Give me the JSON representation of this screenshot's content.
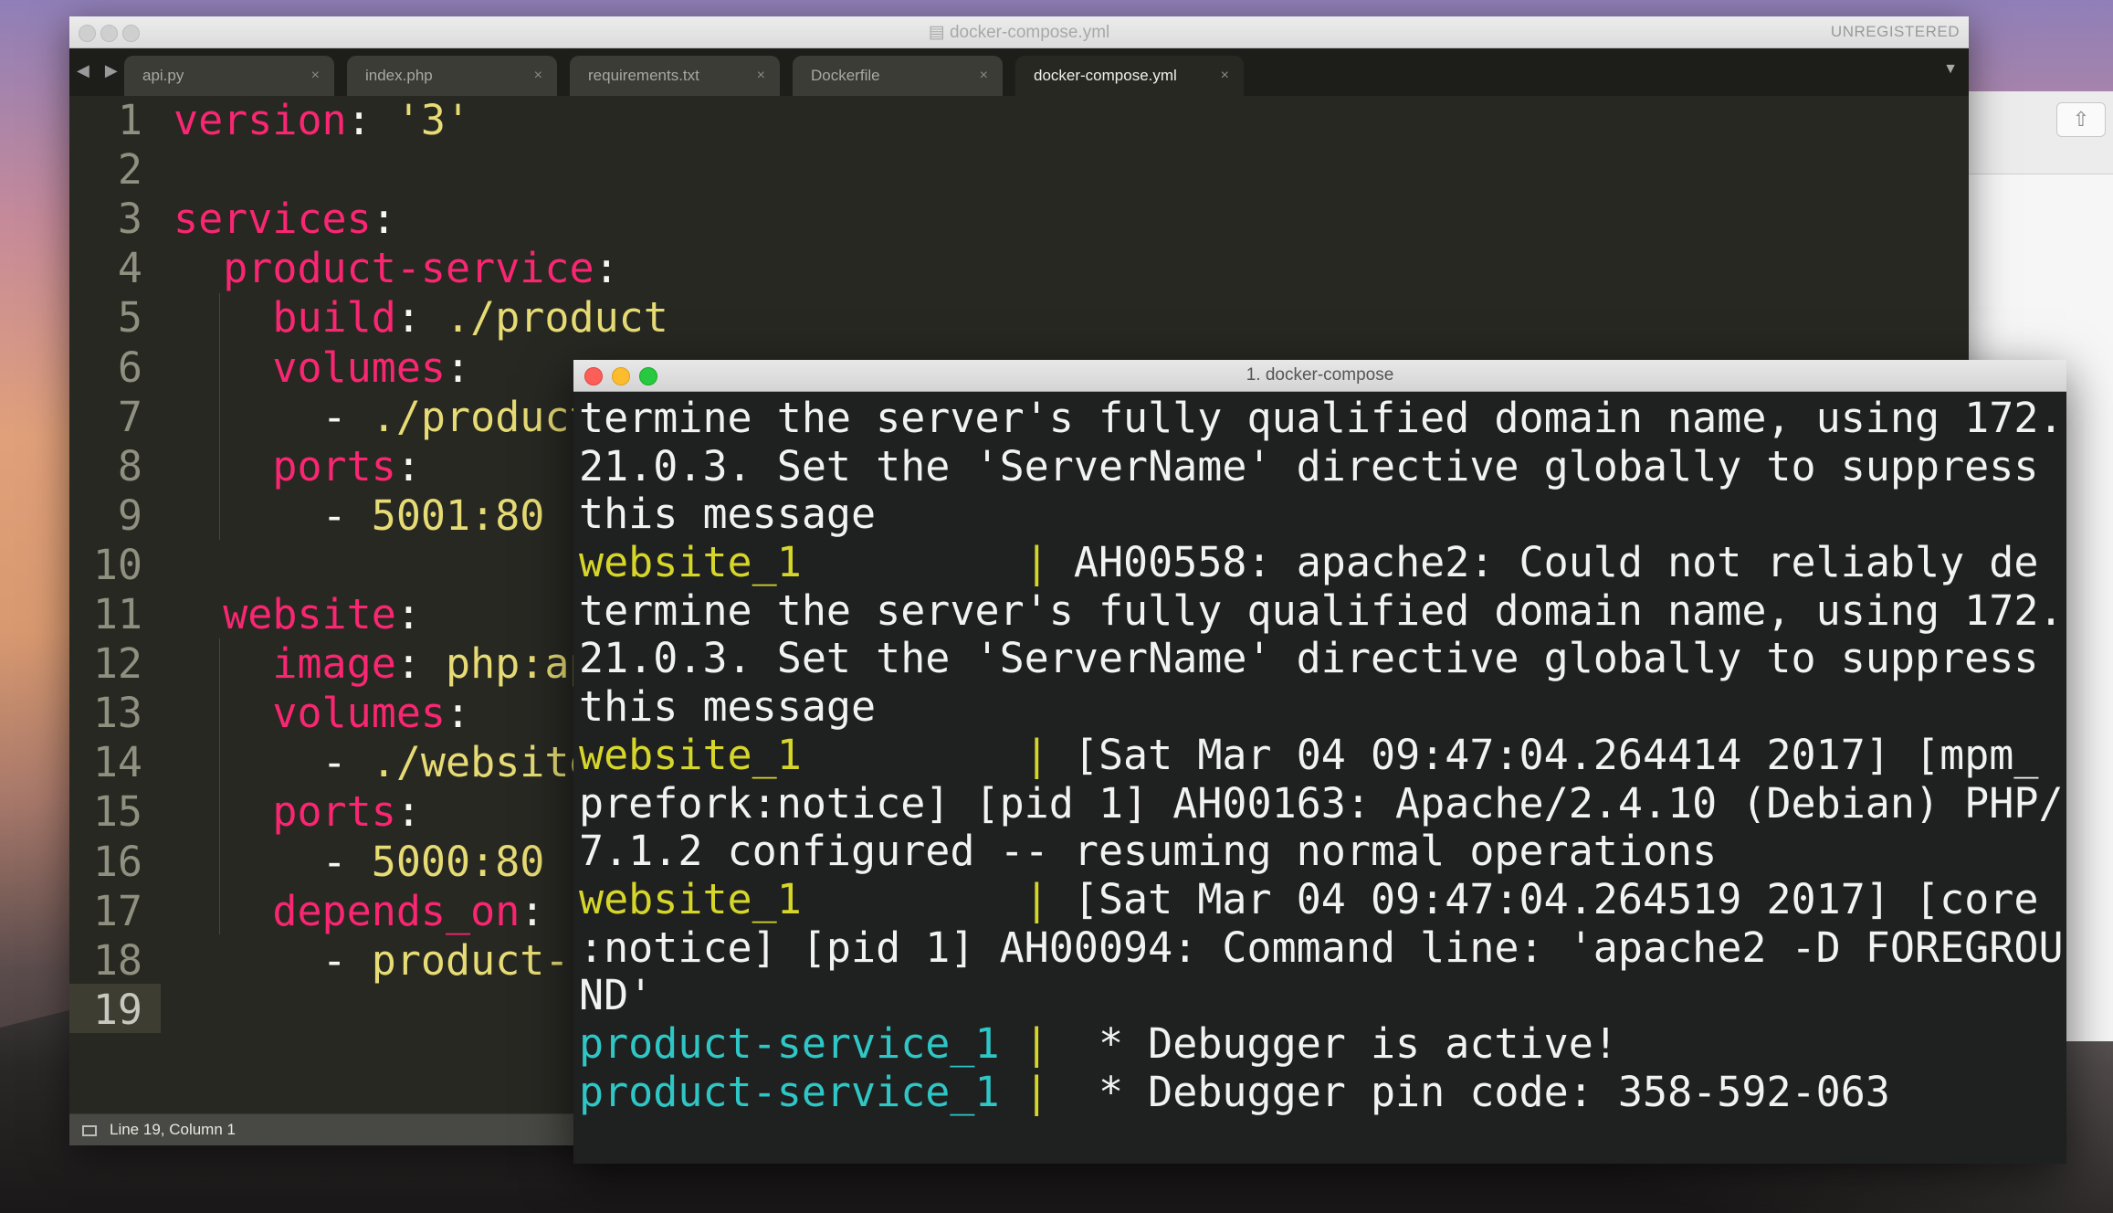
{
  "desktop": {
    "share_icon": "share-icon"
  },
  "sublime": {
    "window_title": "docker-compose.yml",
    "license_label": "UNREGISTERED",
    "nav_arrows": "◀ ▶",
    "tabs": [
      {
        "label": "api.py",
        "close": "×",
        "active": false
      },
      {
        "label": "index.php",
        "close": "×",
        "active": false
      },
      {
        "label": "requirements.txt",
        "close": "×",
        "active": false
      },
      {
        "label": "Dockerfile",
        "close": "×",
        "active": false
      },
      {
        "label": "docker-compose.yml",
        "close": "×",
        "active": true
      }
    ],
    "tab_dropdown": "▼",
    "lines": [
      {
        "num": "1",
        "a": "",
        "k": "version",
        "p": ": ",
        "s": "'3'"
      },
      {
        "num": "2",
        "a": "",
        "k": "",
        "p": "",
        "s": ""
      },
      {
        "num": "3",
        "a": "",
        "k": "services",
        "p": ":",
        "s": ""
      },
      {
        "num": "4",
        "a": "  ",
        "k": "product-service",
        "p": ":",
        "s": ""
      },
      {
        "num": "5",
        "a": "    ",
        "k": "build",
        "p": ": ",
        "s": "./product"
      },
      {
        "num": "6",
        "a": "    ",
        "k": "volumes",
        "p": ":",
        "s": ""
      },
      {
        "num": "7",
        "a": "      ",
        "k": "",
        "p": "- ",
        "s": "./product"
      },
      {
        "num": "8",
        "a": "    ",
        "k": "ports",
        "p": ":",
        "s": ""
      },
      {
        "num": "9",
        "a": "      ",
        "k": "",
        "p": "- ",
        "s": "5001:80"
      },
      {
        "num": "10",
        "a": "",
        "k": "",
        "p": "",
        "s": ""
      },
      {
        "num": "11",
        "a": "  ",
        "k": "website",
        "p": ":",
        "s": ""
      },
      {
        "num": "12",
        "a": "    ",
        "k": "image",
        "p": ": ",
        "s": "php:ap"
      },
      {
        "num": "13",
        "a": "    ",
        "k": "volumes",
        "p": ":",
        "s": ""
      },
      {
        "num": "14",
        "a": "      ",
        "k": "",
        "p": "- ",
        "s": "./website"
      },
      {
        "num": "15",
        "a": "    ",
        "k": "ports",
        "p": ":",
        "s": ""
      },
      {
        "num": "16",
        "a": "      ",
        "k": "",
        "p": "- ",
        "s": "5000:80"
      },
      {
        "num": "17",
        "a": "    ",
        "k": "depends_on",
        "p": ":",
        "s": ""
      },
      {
        "num": "18",
        "a": "      ",
        "k": "",
        "p": "- ",
        "s": "product-s"
      },
      {
        "num": "19",
        "a": "",
        "k": "",
        "p": "",
        "s": ""
      }
    ],
    "status": "Line 19, Column 1"
  },
  "terminal": {
    "title": "1. docker-compose",
    "lines": [
      {
        "prefix": "",
        "prefix_color": "",
        "text": "termine the server's fully qualified domain name, using 172."
      },
      {
        "prefix": "",
        "prefix_color": "",
        "text": "21.0.3. Set the 'ServerName' directive globally to suppress"
      },
      {
        "prefix": "",
        "prefix_color": "",
        "text": "this message"
      },
      {
        "prefix": "website_1",
        "prefix_color": "yellow",
        "text": "         | AH00558: apache2: Could not reliably de"
      },
      {
        "prefix": "",
        "prefix_color": "",
        "text": "termine the server's fully qualified domain name, using 172."
      },
      {
        "prefix": "",
        "prefix_color": "",
        "text": "21.0.3. Set the 'ServerName' directive globally to suppress"
      },
      {
        "prefix": "",
        "prefix_color": "",
        "text": "this message"
      },
      {
        "prefix": "website_1",
        "prefix_color": "yellow",
        "text": "         | [Sat Mar 04 09:47:04.264414 2017] [mpm_"
      },
      {
        "prefix": "",
        "prefix_color": "",
        "text": "prefork:notice] [pid 1] AH00163: Apache/2.4.10 (Debian) PHP/"
      },
      {
        "prefix": "",
        "prefix_color": "",
        "text": "7.1.2 configured -- resuming normal operations"
      },
      {
        "prefix": "website_1",
        "prefix_color": "yellow",
        "text": "         | [Sat Mar 04 09:47:04.264519 2017] [core"
      },
      {
        "prefix": "",
        "prefix_color": "",
        "text": ":notice] [pid 1] AH00094: Command line: 'apache2 -D FOREGROU"
      },
      {
        "prefix": "",
        "prefix_color": "",
        "text": "ND'"
      },
      {
        "prefix": "product-service_1",
        "prefix_color": "cyan",
        "text": " |  * Debugger is active!"
      },
      {
        "prefix": "product-service_1",
        "prefix_color": "cyan",
        "text": " |  * Debugger pin code: 358-592-063"
      }
    ]
  }
}
